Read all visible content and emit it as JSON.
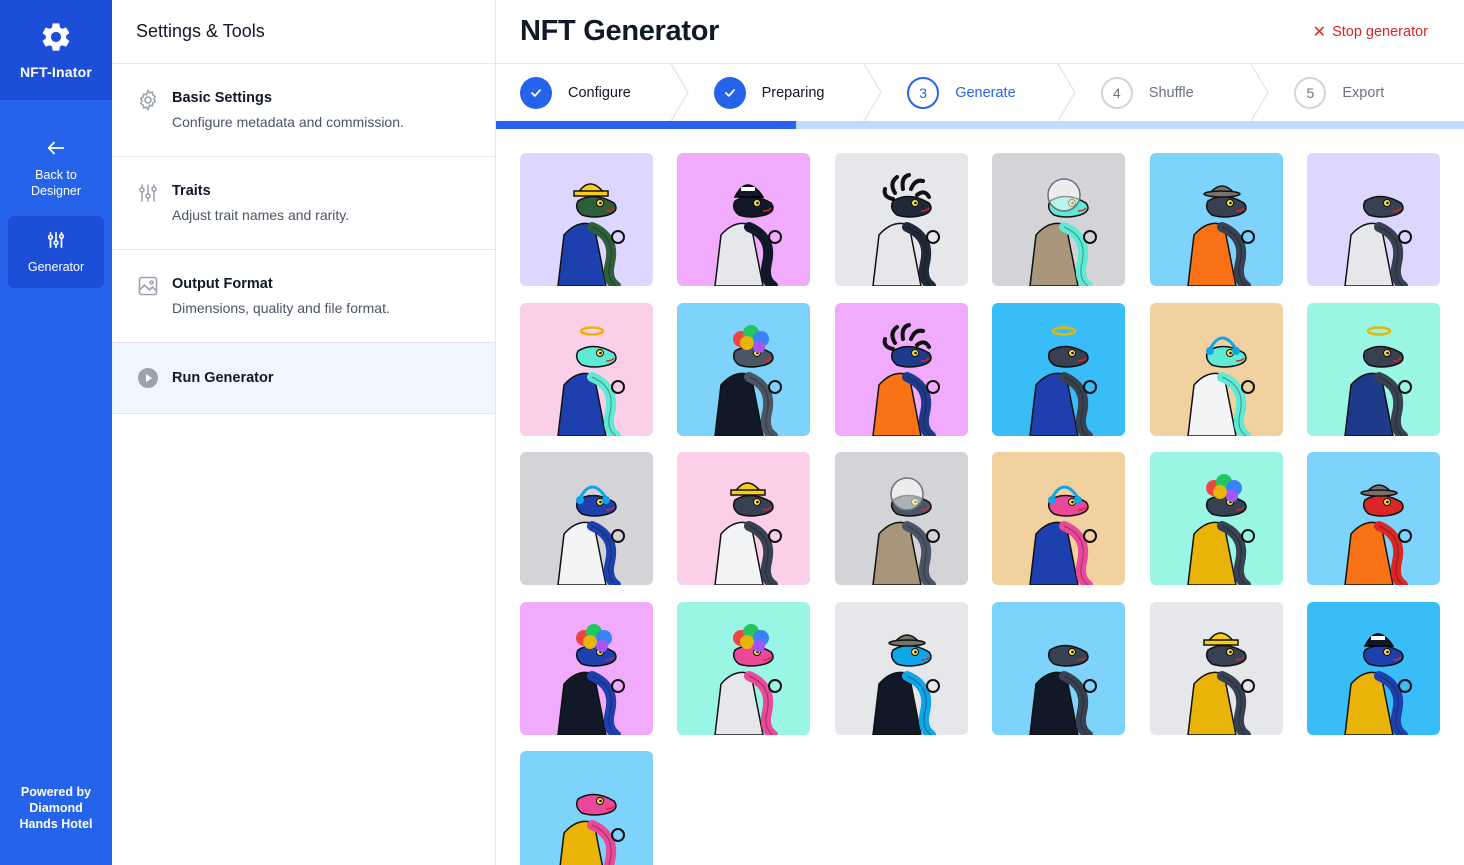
{
  "app": {
    "brand": "NFT-Inator"
  },
  "rail": {
    "back_label_1": "Back to",
    "back_label_2": "Designer",
    "generator_label": "Generator",
    "powered_1": "Powered by",
    "powered_2": "Diamond",
    "powered_3": "Hands Hotel"
  },
  "panel": {
    "title": "Settings & Tools",
    "items": [
      {
        "title": "Basic Settings",
        "desc": "Configure metadata and commission.",
        "icon": "gear-icon"
      },
      {
        "title": "Traits",
        "desc": "Adjust trait names and rarity.",
        "icon": "sliders-icon"
      },
      {
        "title": "Output Format",
        "desc": "Dimensions, quality and file format.",
        "icon": "image-icon"
      },
      {
        "title": "Run Generator",
        "desc": "",
        "icon": "play-icon"
      }
    ]
  },
  "header": {
    "title": "NFT Generator",
    "stop_label": "Stop generator"
  },
  "steps": [
    {
      "num": "1",
      "label": "Configure",
      "state": "done"
    },
    {
      "num": "2",
      "label": "Preparing",
      "state": "done"
    },
    {
      "num": "3",
      "label": "Generate",
      "state": "current"
    },
    {
      "num": "4",
      "label": "Shuffle",
      "state": "todo"
    },
    {
      "num": "5",
      "label": "Export",
      "state": "todo"
    }
  ],
  "progress": {
    "fraction": 0.31
  },
  "colors": {
    "accent": "#2563eb",
    "accent_dark": "#1d4ed8",
    "danger": "#dc2626"
  },
  "gallery": [
    {
      "bg": "#ddd6fe",
      "body": "#1e40af",
      "head": "#2f5f3a",
      "hat": "hardhat"
    },
    {
      "bg": "#f0abfc",
      "body": "#e5e7eb",
      "head": "#111827",
      "hat": "helmet"
    },
    {
      "bg": "#e5e7eb",
      "body": "#e5e7eb",
      "head": "#1f2937",
      "hat": "dreads"
    },
    {
      "bg": "#d4d4d8",
      "body": "#a8957a",
      "head": "#5eead4",
      "hat": "bubble"
    },
    {
      "bg": "#7dd3fc",
      "body": "#f97316",
      "head": "#374151",
      "hat": "fedora"
    },
    {
      "bg": "#ddd6fe",
      "body": "#e5e7eb",
      "head": "#374151",
      "hat": "none"
    },
    {
      "bg": "#fbcfe8",
      "body": "#1e40af",
      "head": "#5eead4",
      "hat": "halo"
    },
    {
      "bg": "#7dd3fc",
      "body": "#111827",
      "head": "#4b5563",
      "hat": "afro"
    },
    {
      "bg": "#f0abfc",
      "body": "#f97316",
      "head": "#1e3a8a",
      "hat": "dreads"
    },
    {
      "bg": "#38bdf8",
      "body": "#1e40af",
      "head": "#374151",
      "hat": "halo"
    },
    {
      "bg": "#f1d1a0",
      "body": "#f3f4f6",
      "head": "#5eead4",
      "hat": "headphones"
    },
    {
      "bg": "#99f6e4",
      "body": "#1e3a8a",
      "head": "#374151",
      "hat": "halo"
    },
    {
      "bg": "#d4d4d8",
      "body": "#f3f4f6",
      "head": "#1e40af",
      "hat": "headphones"
    },
    {
      "bg": "#fbcfe8",
      "body": "#f3f4f6",
      "head": "#374151",
      "hat": "hardhat"
    },
    {
      "bg": "#d4d4d8",
      "body": "#a8957a",
      "head": "#4b5563",
      "hat": "bubble"
    },
    {
      "bg": "#f1d1a0",
      "body": "#1e40af",
      "head": "#ec4899",
      "hat": "headphones"
    },
    {
      "bg": "#99f6e4",
      "body": "#eab308",
      "head": "#374151",
      "hat": "afro"
    },
    {
      "bg": "#7dd3fc",
      "body": "#f97316",
      "head": "#dc2626",
      "hat": "fedora"
    },
    {
      "bg": "#f0abfc",
      "body": "#111827",
      "head": "#1e40af",
      "hat": "afro"
    },
    {
      "bg": "#99f6e4",
      "body": "#e5e7eb",
      "head": "#ec4899",
      "hat": "afro"
    },
    {
      "bg": "#e5e7eb",
      "body": "#111827",
      "head": "#0ea5e9",
      "hat": "fedora"
    },
    {
      "bg": "#7dd3fc",
      "body": "#111827",
      "head": "#374151",
      "hat": "none"
    },
    {
      "bg": "#e5e7eb",
      "body": "#eab308",
      "head": "#374151",
      "hat": "hardhat"
    },
    {
      "bg": "#38bdf8",
      "body": "#eab308",
      "head": "#1e40af",
      "hat": "helmet"
    },
    {
      "bg": "#7dd3fc",
      "body": "#eab308",
      "head": "#ec4899",
      "hat": "none"
    }
  ]
}
